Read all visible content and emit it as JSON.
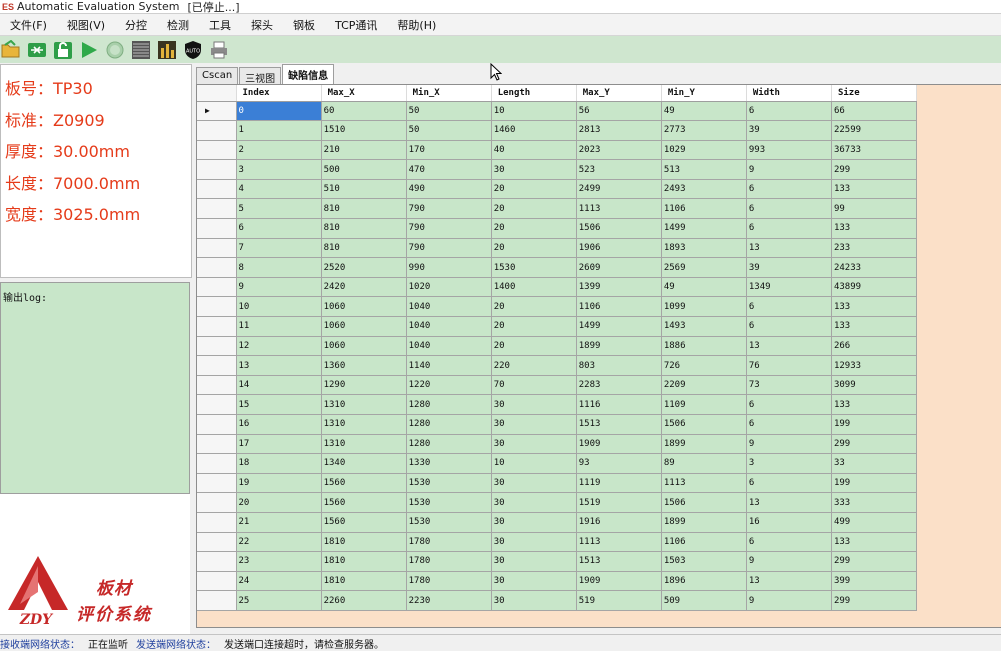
{
  "window": {
    "app_icon": "ES",
    "title": "Automatic Evaluation System",
    "status": "[已停止...]"
  },
  "menu": [
    "文件(F)",
    "视图(V)",
    "分控",
    "检测",
    "工具",
    "探头",
    "钢板",
    "TCP通讯",
    "帮助(H)"
  ],
  "toolbar": {
    "icons": [
      "open-folder-icon",
      "connect-icon",
      "unlock-icon",
      "play-icon",
      "stop-icon",
      "scan-icon",
      "chart-icon",
      "auto-shield-icon",
      "printer-icon"
    ],
    "auto_label": "AUTO"
  },
  "plate_info": {
    "plate_no": "板号：TP30",
    "standard": "标准：Z0909",
    "thickness": "厚度：30.00mm",
    "length": "长度：7000.0mm",
    "width": "宽度：3025.0mm"
  },
  "log": {
    "label": "输出log:"
  },
  "logo": {
    "mark": "ZDY",
    "line1": "板材",
    "line2": "评价系统"
  },
  "tabs": [
    "Cscan",
    "三视图",
    "缺陷信息"
  ],
  "active_tab": 2,
  "table": {
    "columns": [
      "Index",
      "Max_X",
      "Min_X",
      "Length",
      "Max_Y",
      "Min_Y",
      "Width",
      "Size"
    ],
    "selected_row_marker": "▶",
    "rows": [
      [
        "0",
        "60",
        "50",
        "10",
        "56",
        "49",
        "6",
        "66"
      ],
      [
        "1",
        "1510",
        "50",
        "1460",
        "2813",
        "2773",
        "39",
        "22599"
      ],
      [
        "2",
        "210",
        "170",
        "40",
        "2023",
        "1029",
        "993",
        "36733"
      ],
      [
        "3",
        "500",
        "470",
        "30",
        "523",
        "513",
        "9",
        "299"
      ],
      [
        "4",
        "510",
        "490",
        "20",
        "2499",
        "2493",
        "6",
        "133"
      ],
      [
        "5",
        "810",
        "790",
        "20",
        "1113",
        "1106",
        "6",
        "99"
      ],
      [
        "6",
        "810",
        "790",
        "20",
        "1506",
        "1499",
        "6",
        "133"
      ],
      [
        "7",
        "810",
        "790",
        "20",
        "1906",
        "1893",
        "13",
        "233"
      ],
      [
        "8",
        "2520",
        "990",
        "1530",
        "2609",
        "2569",
        "39",
        "24233"
      ],
      [
        "9",
        "2420",
        "1020",
        "1400",
        "1399",
        "49",
        "1349",
        "43899"
      ],
      [
        "10",
        "1060",
        "1040",
        "20",
        "1106",
        "1099",
        "6",
        "133"
      ],
      [
        "11",
        "1060",
        "1040",
        "20",
        "1499",
        "1493",
        "6",
        "133"
      ],
      [
        "12",
        "1060",
        "1040",
        "20",
        "1899",
        "1886",
        "13",
        "266"
      ],
      [
        "13",
        "1360",
        "1140",
        "220",
        "803",
        "726",
        "76",
        "12933"
      ],
      [
        "14",
        "1290",
        "1220",
        "70",
        "2283",
        "2209",
        "73",
        "3099"
      ],
      [
        "15",
        "1310",
        "1280",
        "30",
        "1116",
        "1109",
        "6",
        "133"
      ],
      [
        "16",
        "1310",
        "1280",
        "30",
        "1513",
        "1506",
        "6",
        "199"
      ],
      [
        "17",
        "1310",
        "1280",
        "30",
        "1909",
        "1899",
        "9",
        "299"
      ],
      [
        "18",
        "1340",
        "1330",
        "10",
        "93",
        "89",
        "3",
        "33"
      ],
      [
        "19",
        "1560",
        "1530",
        "30",
        "1119",
        "1113",
        "6",
        "199"
      ],
      [
        "20",
        "1560",
        "1530",
        "30",
        "1519",
        "1506",
        "13",
        "333"
      ],
      [
        "21",
        "1560",
        "1530",
        "30",
        "1916",
        "1899",
        "16",
        "499"
      ],
      [
        "22",
        "1810",
        "1780",
        "30",
        "1113",
        "1106",
        "6",
        "133"
      ],
      [
        "23",
        "1810",
        "1780",
        "30",
        "1513",
        "1503",
        "9",
        "299"
      ],
      [
        "24",
        "1810",
        "1780",
        "30",
        "1909",
        "1896",
        "13",
        "399"
      ],
      [
        "25",
        "2260",
        "2230",
        "30",
        "519",
        "509",
        "9",
        "299"
      ]
    ]
  },
  "statusbar": {
    "recv_label": "接收端网络状态：",
    "recv_value": "正在监听",
    "send_label": "发送端网络状态：",
    "send_value": "发送端口连接超时，请检查服务器。"
  },
  "colors": {
    "grid_cell": "#c8e6c9",
    "selected_cell": "#3b7fd6",
    "info_text": "#e53b1a",
    "grid_background": "#fbe0c8",
    "toolbar_bg": "#cfe6cf"
  }
}
